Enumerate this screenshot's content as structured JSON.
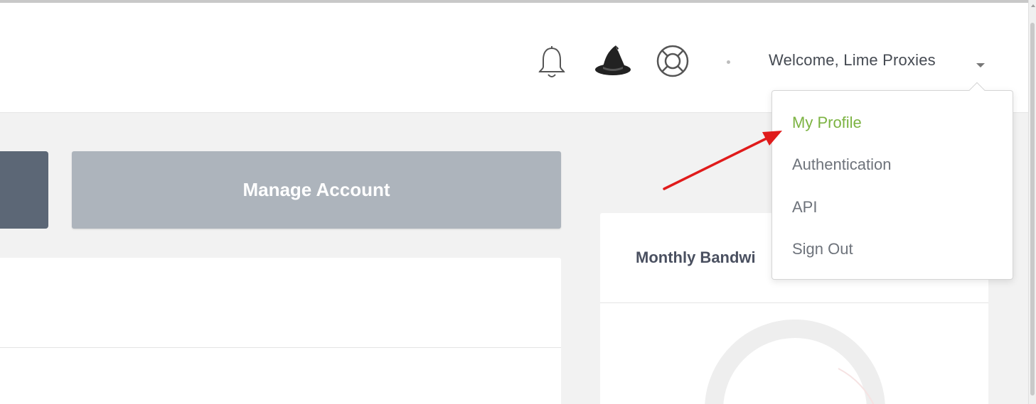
{
  "header": {
    "welcome_text": "Welcome, Lime Proxies",
    "icons": [
      "bell-icon",
      "wizard-hat-icon",
      "lifebuoy-icon",
      "chevron-down-icon"
    ]
  },
  "actions": {
    "manage_account_label": "Manage Account"
  },
  "widgets": {
    "monthly_bandwidth_title": "Monthly Bandwi"
  },
  "user_menu": {
    "items": [
      {
        "label": "My Profile",
        "active": true
      },
      {
        "label": "Authentication",
        "active": false
      },
      {
        "label": "API",
        "active": false
      },
      {
        "label": "Sign Out",
        "active": false
      }
    ]
  },
  "colors": {
    "accent_green": "#7cb342",
    "dark_button": "#5c6776",
    "manage_button": "#adb4bc",
    "annotation_arrow": "#e01b1b",
    "gauge_track": "#eeeeee"
  }
}
